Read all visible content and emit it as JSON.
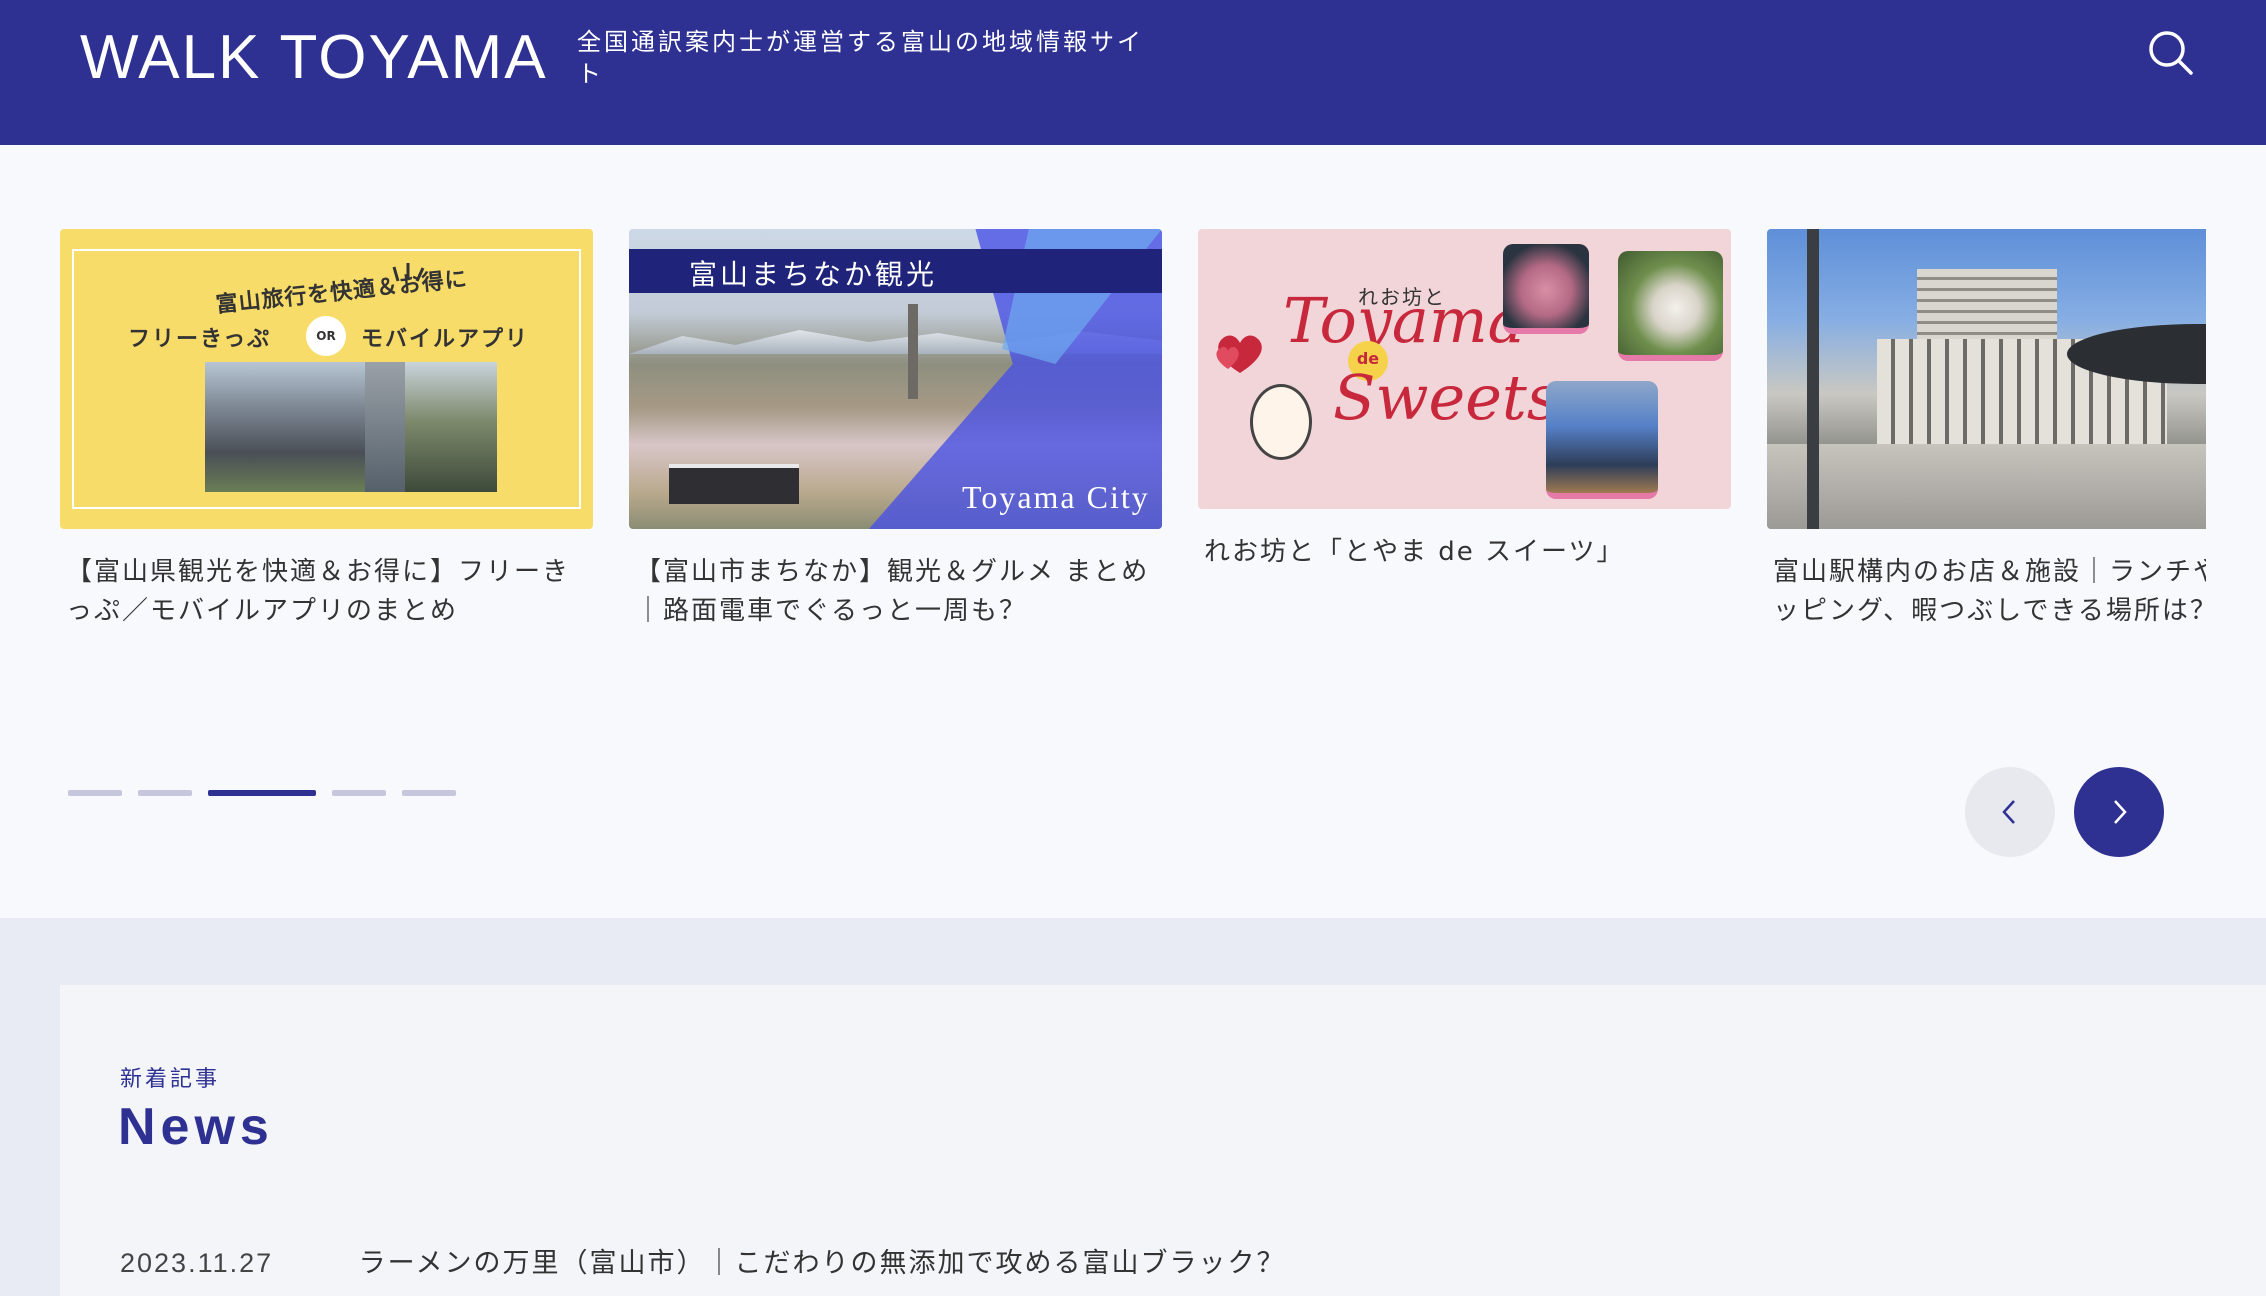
{
  "header": {
    "logo": "WALK TOYAMA",
    "tagline": "全国通訳案内士が運営する富山の地域情報サイト",
    "search_icon": "search-icon",
    "bg_color": "#2e3192"
  },
  "carousel": {
    "slides": [
      {
        "title": "【富山県観光を快適＆お得に】フリーきっぷ／モバイルアプリのまとめ",
        "thumb": {
          "line1": "富山旅行を快適＆お得に",
          "left": "フリーきっぷ",
          "or": "OR",
          "right": "モバイルアプリ"
        }
      },
      {
        "title": "【富山市まちなか】観光＆グルメ まとめ｜路面電車でぐるっと一周も？",
        "thumb": {
          "banner": "富山まちなか観光",
          "caption": "Toyama City"
        }
      },
      {
        "title": "れお坊と「とやま de スイーツ」",
        "thumb": {
          "small": "れお坊と",
          "big1": "Toyama",
          "de": "de",
          "big2": "Sweets"
        }
      },
      {
        "title": "富山駅構内のお店＆施設｜ランチやショッピング、暇つぶしできる場所は？",
        "thumb": {}
      }
    ],
    "pagination": {
      "count": 5,
      "active_index": 2
    },
    "prev_icon": "chevron-left-icon",
    "next_icon": "chevron-right-icon"
  },
  "news": {
    "kicker": "新着記事",
    "heading": "News",
    "items": [
      {
        "date": "2023.11.27",
        "title": "ラーメンの万里（富山市）｜こだわりの無添加で攻める富山ブラック？"
      }
    ]
  }
}
